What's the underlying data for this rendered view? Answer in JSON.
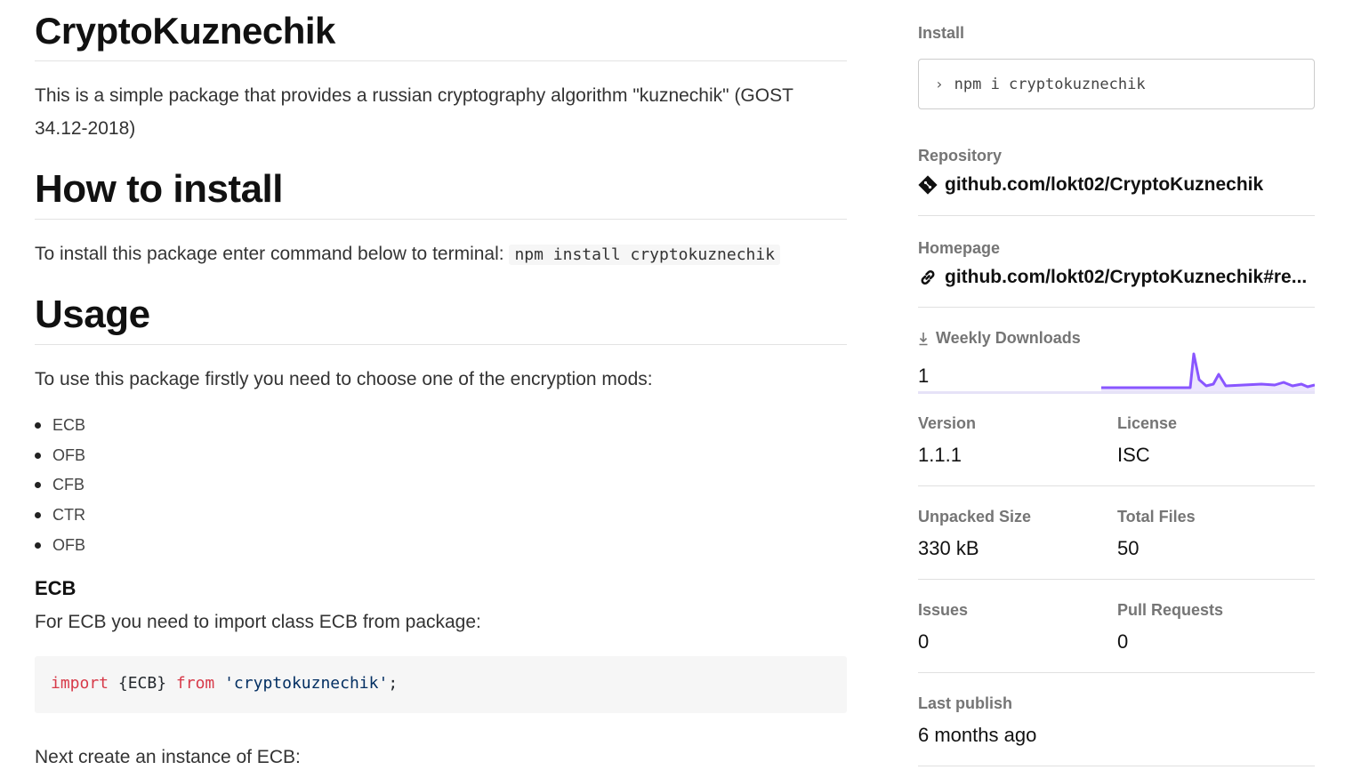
{
  "readme": {
    "title": "CryptoKuznechik",
    "intro": "This is a simple package that provides a russian cryptography algorithm \"kuznechik\" (GOST 34.12-2018)",
    "install_heading": "How to install",
    "install_text": "To install this package enter command below to terminal:",
    "install_code": "npm install cryptokuznechik",
    "usage_heading": "Usage",
    "usage_text": "To use this package firstly you need to choose one of the encryption mods:",
    "modes": [
      "ECB",
      "OFB",
      "CFB",
      "CTR",
      "OFB"
    ],
    "ecb_heading": "ECB",
    "ecb_text": "For ECB you need to import class ECB from package:",
    "code": {
      "kw_import": "import",
      "braces": " {ECB} ",
      "kw_from": "from",
      "space": " ",
      "string": "'cryptokuznechik'",
      "semicolon": ";"
    },
    "next_text": "Next create an instance of ECB:"
  },
  "sidebar": {
    "install_label": "Install",
    "install_prompt": "›",
    "install_command": "npm i cryptokuznechik",
    "repository_label": "Repository",
    "repository_link": "github.com/lokt02/CryptoKuznechik",
    "repository_icon": "git-icon",
    "homepage_label": "Homepage",
    "homepage_link": "github.com/lokt02/CryptoKuznechik#re...",
    "homepage_icon": "link-icon",
    "downloads_label": "Weekly Downloads",
    "downloads_value": "1",
    "downloads_icon": "download-icon",
    "version_label": "Version",
    "version_value": "1.1.1",
    "license_label": "License",
    "license_value": "ISC",
    "unpacked_label": "Unpacked Size",
    "unpacked_value": "330 kB",
    "files_label": "Total Files",
    "files_value": "50",
    "issues_label": "Issues",
    "issues_value": "0",
    "pulls_label": "Pull Requests",
    "pulls_value": "0",
    "publish_label": "Last publish",
    "publish_value": "6 months ago"
  },
  "colors": {
    "sparkline": "#8956ff",
    "code_keyword": "#d73a49",
    "code_string": "#032f62"
  }
}
